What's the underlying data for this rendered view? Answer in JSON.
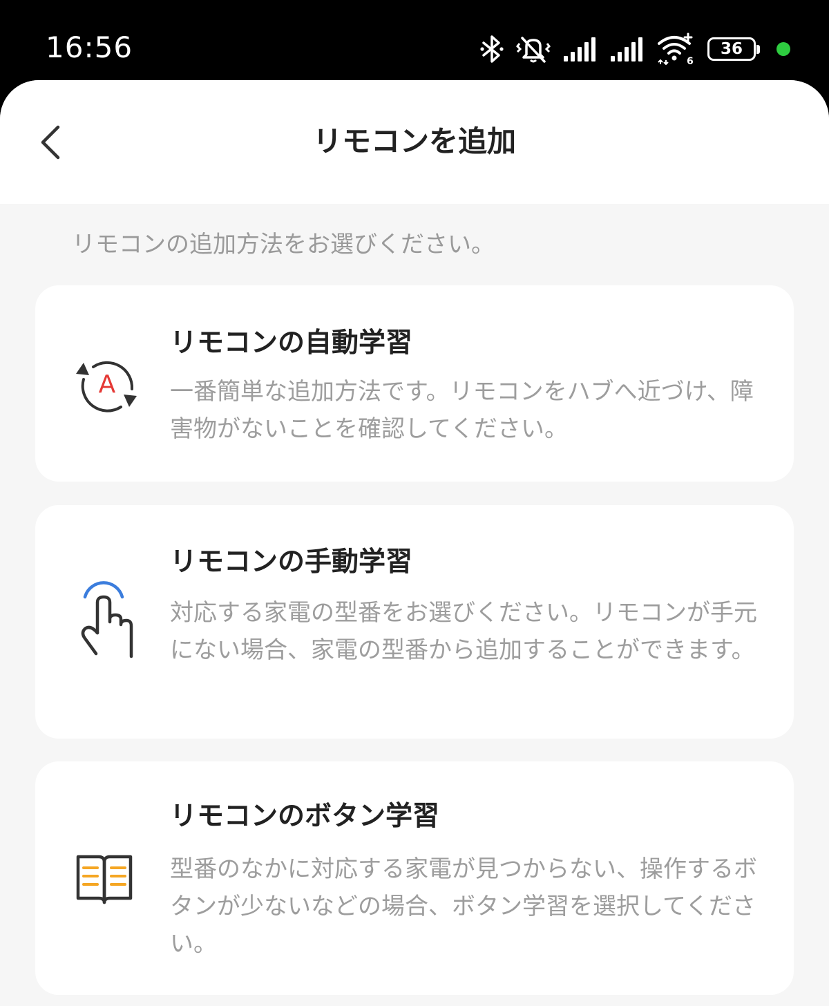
{
  "status_bar": {
    "time": "16:56",
    "battery_level": "36",
    "icons": [
      "bluetooth-icon",
      "vibrate-off-icon",
      "signal-icon",
      "signal-icon",
      "wifi-6-icon",
      "battery-icon",
      "status-dot"
    ],
    "dot_color": "#2ecc40"
  },
  "header": {
    "title": "リモコンを追加",
    "back_icon": "chevron-left-icon"
  },
  "subtitle": "リモコンの追加方法をお選びください。",
  "options": [
    {
      "title": "リモコンの自動学習",
      "description": "一番簡単な追加方法です。リモコンをハブへ近づけ、障害物がないことを確認してください。",
      "icon": "auto-sync-a-icon",
      "icon_letter": "A",
      "accent": "#e53935"
    },
    {
      "title": "リモコンの手動学習",
      "description": "対応する家電の型番をお選びください。リモコンが手元にない場合、家電の型番から追加することができます。",
      "icon": "tap-hand-icon",
      "accent": "#3b7ddd"
    },
    {
      "title": "リモコンのボタン学習",
      "description": "型番のなかに対応する家電が見つからない、操作するボタンが少ないなどの場合、ボタン学習を選択してください。",
      "icon": "open-book-icon",
      "accent": "#f5a623"
    }
  ]
}
